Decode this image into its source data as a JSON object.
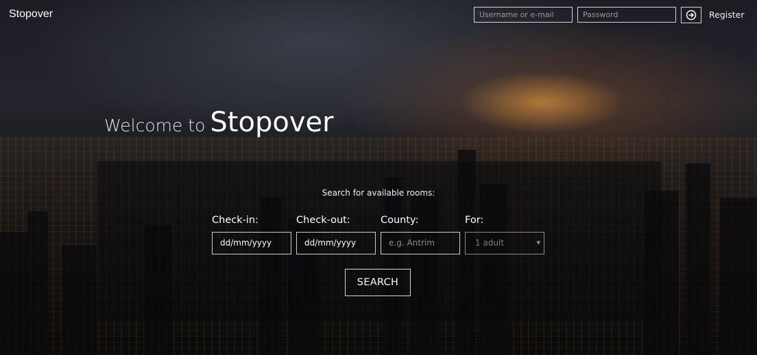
{
  "header": {
    "brand": "Stopover",
    "username_placeholder": "Username or e-mail",
    "password_placeholder": "Password",
    "login_icon": "arrow-right-circle-icon",
    "register_label": "Register"
  },
  "hero": {
    "welcome_prefix": "Welcome to",
    "welcome_name": "Stopover"
  },
  "search": {
    "caption": "Search for available rooms:",
    "checkin_label": "Check-in:",
    "checkin_value": "dd/mm/yyyy",
    "checkout_label": "Check-out:",
    "checkout_value": "dd/mm/yyyy",
    "county_label": "County:",
    "county_placeholder": "e.g. Antrim",
    "for_label": "For:",
    "for_selected": "1 adult",
    "button_label": "SEARCH"
  }
}
